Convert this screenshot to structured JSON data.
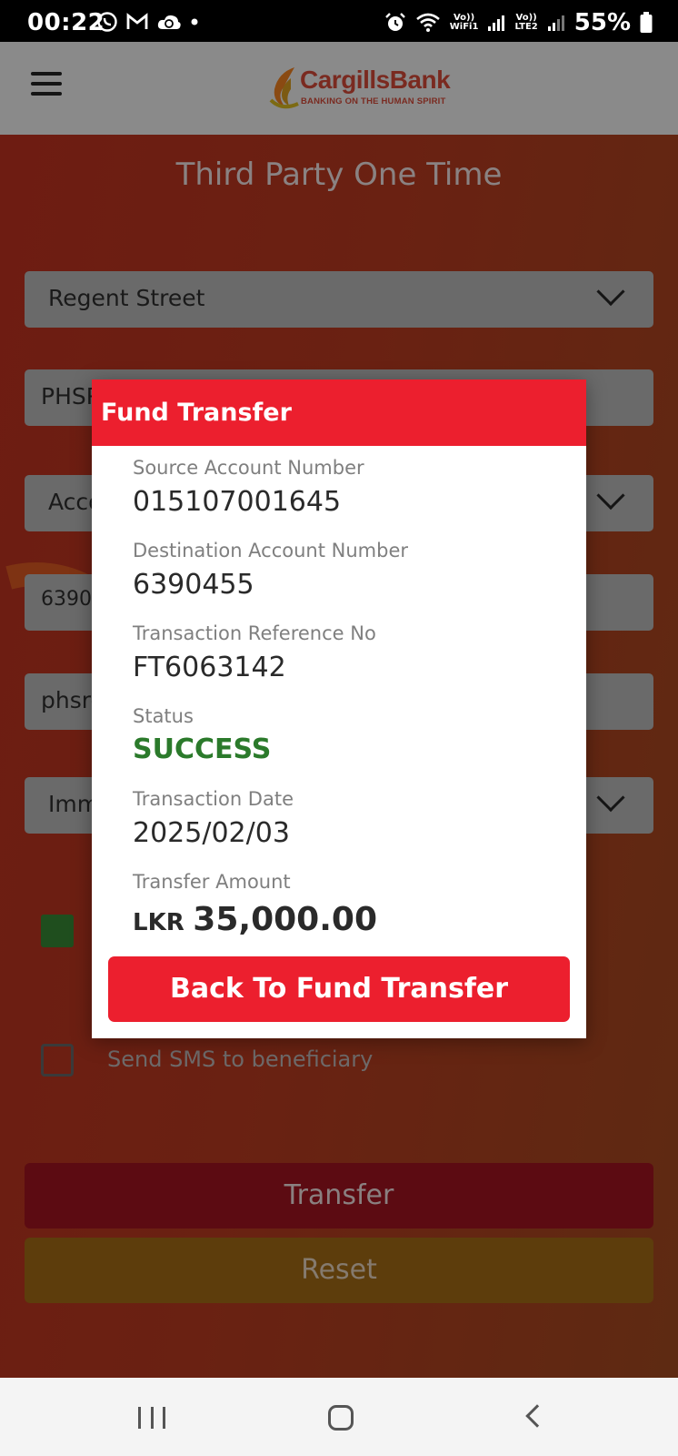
{
  "status_bar": {
    "time": "00:22",
    "battery": "55%",
    "wifi_label_top": "Vo))",
    "wifi_label_bottom": "WiFi1",
    "lte_label_top": "Vo))",
    "lte_label_bottom": "LTE2"
  },
  "header": {
    "logo_name": "CargillsBank",
    "logo_tagline": "BANKING ON THE  HUMAN SPIRIT"
  },
  "form": {
    "title": "Third Party One Time",
    "branch": "Regent Street",
    "field2_partial": "PHSR",
    "field3_partial": "Acco",
    "field4_partial": "6390",
    "field5_partial": "phsre",
    "field6_partial": "Imm",
    "sms_label": "Send SMS to beneficiary",
    "transfer_label": "Transfer",
    "reset_label": "Reset"
  },
  "dialog": {
    "title": "Fund Transfer",
    "source_label": "Source Account Number",
    "source_value": "015107001645",
    "destination_label": "Destination Account Number",
    "destination_value": "6390455",
    "reference_label": "Transaction Reference No",
    "reference_value": "FT6063142",
    "status_label": "Status",
    "status_value": "SUCCESS",
    "date_label": "Transaction Date",
    "date_value": "2025/02/03",
    "amount_label": "Transfer Amount",
    "amount_currency": "LKR",
    "amount_value": "35,000.00",
    "back_button": "Back To Fund Transfer"
  },
  "colors": {
    "accent_red": "#ec1f2e",
    "success_green": "#2b7a2b"
  },
  "icons": [
    "whatsapp-icon",
    "gmail-icon",
    "cloud-sync-icon",
    "alarm-icon",
    "wifi-icon",
    "signal-icon",
    "battery-icon",
    "hamburger-menu-icon",
    "chevron-down-icon",
    "recents-icon",
    "home-icon",
    "back-icon"
  ]
}
